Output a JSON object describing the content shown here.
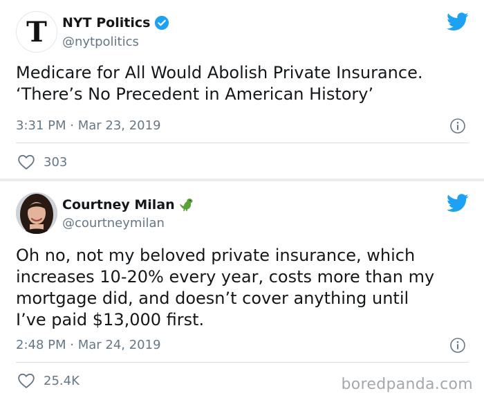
{
  "tweets": [
    {
      "name": "NYT Politics",
      "handle": "@nytpolitics",
      "verified": true,
      "avatar_letter": "T",
      "text_lines": [
        "Medicare for All Would Abolish Private Insurance.",
        "‘There’s No Precedent in American History’"
      ],
      "timestamp": "3:31 PM · Mar 23, 2019",
      "likes": "303"
    },
    {
      "name": "Courtney Milan",
      "handle": "@courtneymilan",
      "verified": false,
      "text_lines": [
        "Oh no, not my beloved private insurance, which",
        "increases 10-20% every year, costs more than my",
        "mortgage did, and doesn’t cover anything until",
        "I’ve paid $13,000 first."
      ],
      "timestamp": "2:48 PM · Mar 24, 2019",
      "likes": "25.4K"
    }
  ],
  "watermark": "boredpanda.com",
  "icons": {
    "verified": "verified-badge-icon",
    "twitter": "twitter-bird-icon",
    "info": "info-icon",
    "like": "heart-icon",
    "emoji": "dinosaur-emoji-icon"
  },
  "colors": {
    "twitter_blue": "#1da1f2",
    "text": "#14171a",
    "secondary": "#657786",
    "background": "#e9edf0"
  }
}
